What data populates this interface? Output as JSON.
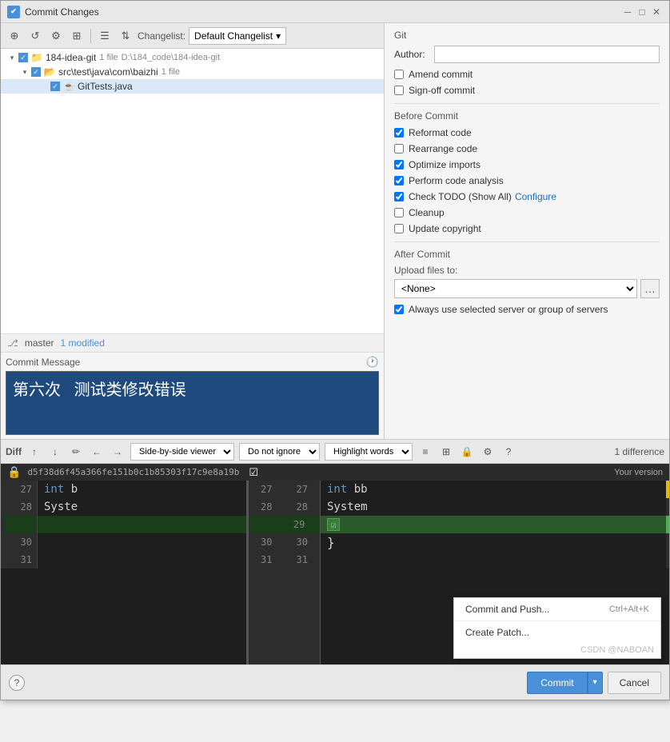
{
  "window": {
    "title": "Commit Changes",
    "icon": "✔"
  },
  "toolbar": {
    "changelist_label": "Changelist:",
    "changelist_value": "Default Changelist"
  },
  "file_tree": {
    "items": [
      {
        "id": "root",
        "name": "184-idea-git",
        "count": "1 file",
        "path": "D:\\184_code\\184-idea-git",
        "level": 0,
        "checked": true,
        "type": "repo"
      },
      {
        "id": "src",
        "name": "src\\test\\java\\com\\baizhi",
        "count": "1 file",
        "path": "",
        "level": 1,
        "checked": true,
        "type": "folder"
      },
      {
        "id": "file",
        "name": "GitTests.java",
        "count": "",
        "path": "",
        "level": 2,
        "checked": true,
        "type": "file"
      }
    ]
  },
  "status_bar": {
    "branch": "master",
    "modified": "1 modified"
  },
  "commit_message": {
    "label": "Commit Message",
    "value": "第六次   测试类修改错误"
  },
  "git_section": {
    "title": "Git",
    "author_label": "Author:",
    "author_value": ""
  },
  "before_commit": {
    "title": "Before Commit",
    "options": [
      {
        "id": "reformat",
        "label": "Reformat code",
        "checked": true
      },
      {
        "id": "rearrange",
        "label": "Rearrange code",
        "checked": false
      },
      {
        "id": "optimize",
        "label": "Optimize imports",
        "checked": true
      },
      {
        "id": "analysis",
        "label": "Perform code analysis",
        "checked": true
      },
      {
        "id": "check_todo",
        "label": "Check TODO (Show All)",
        "checked": true,
        "has_link": true,
        "link_text": "Configure"
      },
      {
        "id": "cleanup",
        "label": "Cleanup",
        "checked": false
      },
      {
        "id": "copyright",
        "label": "Update copyright",
        "checked": false
      }
    ]
  },
  "checkboxes_git": [
    {
      "id": "amend",
      "label": "Amend commit",
      "checked": false
    },
    {
      "id": "signoff",
      "label": "Sign-off commit",
      "checked": false
    }
  ],
  "after_commit": {
    "title": "After Commit",
    "upload_label": "Upload files to:",
    "upload_value": "<None>",
    "always_label": "Always use selected server or group of servers",
    "always_checked": true
  },
  "bottom": {
    "help": "?",
    "commit_label": "Commit",
    "commit_arrow": "▾",
    "cancel_label": "Cancel"
  },
  "diff": {
    "title": "Diff",
    "viewer_label": "Side-by-side viewer",
    "ignore_label": "Do not ignore",
    "highlight_label": "Highlight words",
    "count": "1 difference",
    "hash": "d5f38d6f45a366fe151b0c1b85303f17c9e8a19b",
    "your_version": "Your version",
    "lines": [
      {
        "num_l": "27",
        "num_r": "27",
        "left_code": "int b",
        "right_code": "int bb",
        "type": "normal"
      },
      {
        "num_l": "28",
        "num_r": "28",
        "left_code": "Syste",
        "right_code": "System",
        "type": "normal"
      },
      {
        "num_l": "",
        "num_r": "29",
        "left_code": "",
        "right_code": "}",
        "type": "added"
      },
      {
        "num_l": "30",
        "num_r": "30",
        "left_code": "",
        "right_code": "}",
        "type": "normal"
      },
      {
        "num_l": "31",
        "num_r": "31",
        "left_code": "...",
        "right_code": "...",
        "type": "normal"
      }
    ]
  },
  "dropdown": {
    "items": [
      {
        "label": "Commit and Push...",
        "shortcut": "Ctrl+Alt+K"
      },
      {
        "label": "Create Patch...",
        "shortcut": ""
      }
    ],
    "watermark": "CSDN @NABOAN"
  }
}
